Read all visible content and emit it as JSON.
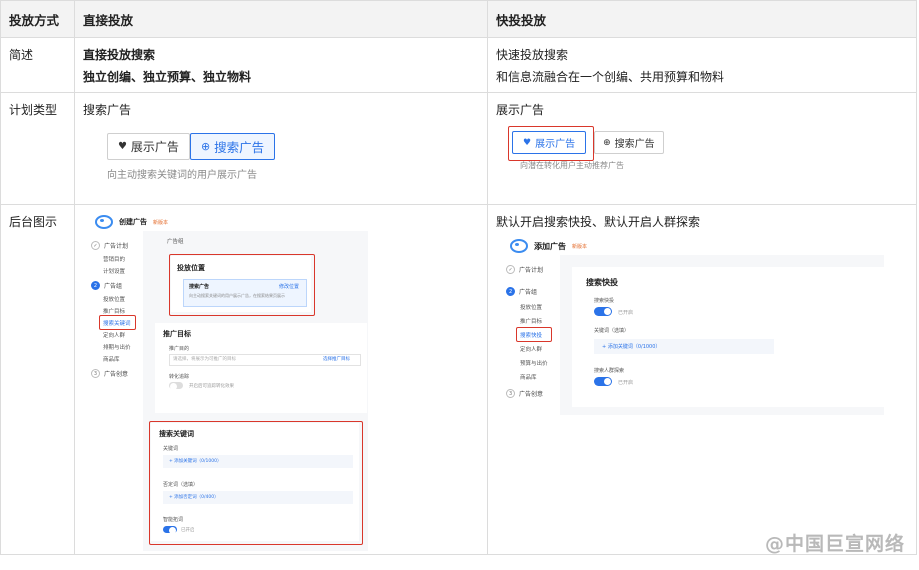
{
  "header": {
    "col1": "投放方式",
    "col2": "直接投放",
    "col3": "快投投放"
  },
  "rows": {
    "summary": {
      "label": "简述",
      "direct_line1": "直接投放搜索",
      "direct_line2": "独立创编、独立预算、独立物料",
      "quick_line1": "快速投放搜索",
      "quick_line2": "和信息流融合在一个创编、共用预算和物料"
    },
    "plan_type": {
      "label": "计划类型",
      "direct_text": "搜索广告",
      "direct_btn_display": "展示广告",
      "direct_btn_search": "搜索广告",
      "direct_hint": "向主动搜索关键词的用户展示广告",
      "quick_text": "展示广告",
      "quick_btn_display": "展示广告",
      "quick_btn_search": "搜索广告",
      "quick_hint": "向潜在转化用户主动推荐广告"
    },
    "backend": {
      "label": "后台图示",
      "quick_text": "默认开启搜索快投、默认开启人群探索"
    }
  },
  "mock_direct": {
    "title": "创建广告",
    "badge": "新版本",
    "steps": [
      "广告计划",
      "广告组",
      "广告创意"
    ],
    "sub_items_1": [
      "营销目的",
      "计划设置"
    ],
    "sub_items_2": [
      "投放位置",
      "推广目标",
      "搜索关键词",
      "定向人群",
      "排期与出价",
      "商品库"
    ],
    "group_label": "广告组",
    "placement": {
      "title": "投放位置",
      "option": "搜索广告",
      "option_link": "修改位置",
      "option_desc": "向主动搜索关键词的用户展示广告，在搜索结果页展示"
    },
    "target": {
      "title": "推广目标",
      "field": "推广目的",
      "placeholder": "请选择，将展示为可推广的目标",
      "link": "选择推广目标",
      "toggle_label": "转化追踪",
      "toggle_desc": "开启后可追踪转化效果"
    },
    "keywords": {
      "title": "搜索关键词",
      "field1": "关键词",
      "add1": "+ 添加关键词（0/1000）",
      "field2": "否定词（选填）",
      "add2": "+ 添加否定词（0/400）",
      "field3": "智能拓词",
      "toggle_label": "已开启"
    }
  },
  "mock_quick": {
    "title": "添加广告",
    "badge": "新版本",
    "steps": [
      "广告计划",
      "广告组",
      "广告创意"
    ],
    "sub_items": [
      "投放位置",
      "推广目标",
      "搜索快投",
      "定向人群",
      "预算与出价",
      "商品库"
    ],
    "panel_title": "搜索快投",
    "field1": "搜索快投",
    "toggle1": "已开启",
    "field2": "关键词（选填）",
    "add": "+ 添加关键词（0/1000）",
    "field3": "搜索人群探索",
    "toggle3": "已开启"
  },
  "watermark": "@中国巨宣网络",
  "colors": {
    "accent": "#2b73e8",
    "highlight_red": "#d9372b",
    "header_bg": "#f3f3f3"
  }
}
